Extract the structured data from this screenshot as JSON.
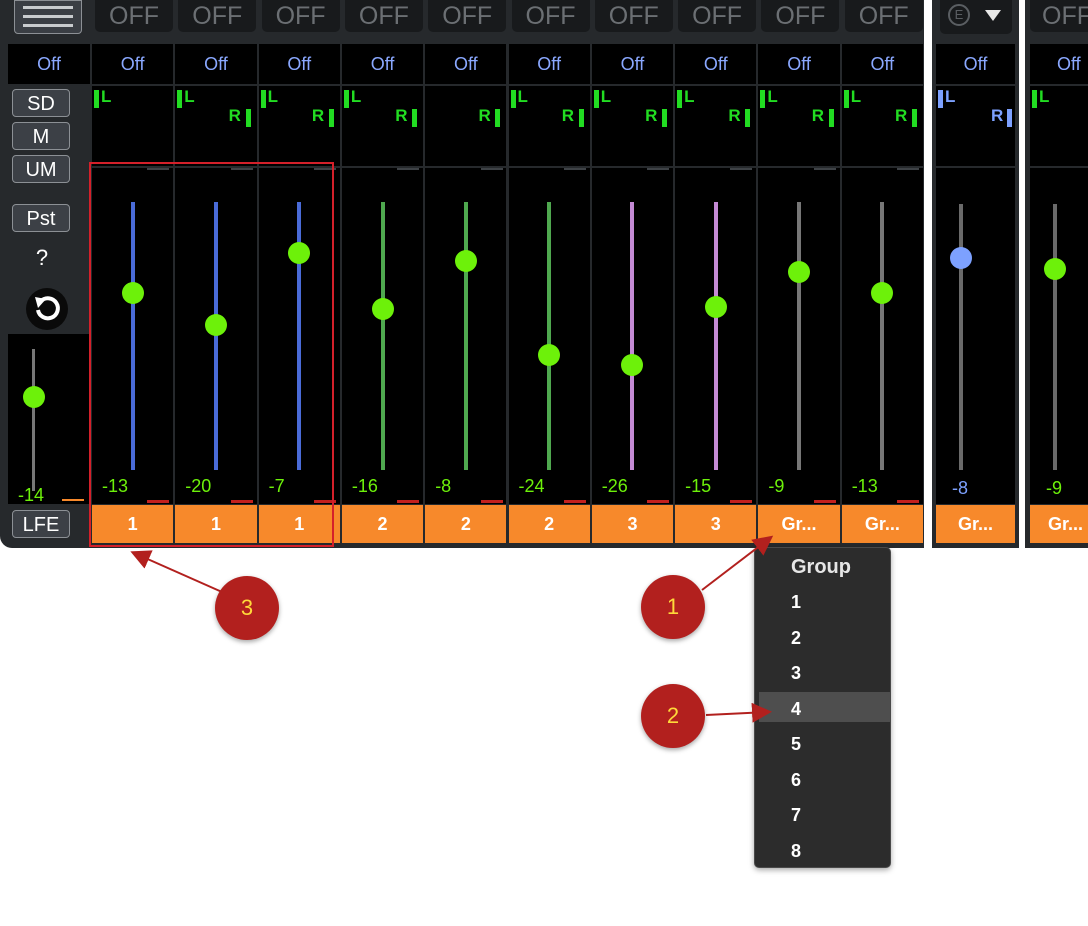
{
  "colors": {
    "panel": "#26292c",
    "fader_knob": "#6df10a",
    "fader_knob_selected": "#7da1ff",
    "route_text": "#8aa8ff",
    "group_button": "#f7892b",
    "callout": "#b2201e",
    "callout_text": "#ffd93a",
    "annotation_red": "#d4202a"
  },
  "top_bar": {
    "menu_icon": "hamburger-icon",
    "buttons": [
      "OFF",
      "OFF",
      "OFF",
      "OFF",
      "OFF",
      "OFF",
      "OFF",
      "OFF",
      "OFF",
      "OFF"
    ],
    "e_dropdown": {
      "label": "E",
      "icon": "chevron-down-icon"
    },
    "partial_button": "OFF"
  },
  "side_panel": {
    "route_label": "Off",
    "buttons": [
      "SD",
      "M",
      "UM",
      "Pst"
    ],
    "help": "?",
    "reset_icon": "reset-icon",
    "lfe_value": "-14",
    "lfe_level": 0.66,
    "lfe_button": "LFE"
  },
  "channels": [
    {
      "route": "Off",
      "pan": "L",
      "db": "-13",
      "group": "1",
      "level": 0.66,
      "color": "#4a6bd8"
    },
    {
      "route": "Off",
      "pan": "LR",
      "db": "-20",
      "group": "1",
      "level": 0.54,
      "color": "#4a6bd8"
    },
    {
      "route": "Off",
      "pan": "LR",
      "db": "-7",
      "group": "1",
      "level": 0.81,
      "color": "#4a6bd8"
    },
    {
      "route": "Off",
      "pan": "LR",
      "db": "-16",
      "group": "2",
      "level": 0.6,
      "color": "#4fa84f"
    },
    {
      "route": "Off",
      "pan": "R",
      "db": "-8",
      "group": "2",
      "level": 0.78,
      "color": "#4fa84f"
    },
    {
      "route": "Off",
      "pan": "LR",
      "db": "-24",
      "group": "2",
      "level": 0.43,
      "color": "#4fa84f"
    },
    {
      "route": "Off",
      "pan": "LR",
      "db": "-26",
      "group": "3",
      "level": 0.39,
      "color": "#c48ad4"
    },
    {
      "route": "Off",
      "pan": "LR",
      "db": "-15",
      "group": "3",
      "level": 0.61,
      "color": "#c48ad4"
    },
    {
      "route": "Off",
      "pan": "LR",
      "db": "-9",
      "group": "Gr...",
      "level": 0.74,
      "color": "#777777"
    },
    {
      "route": "Off",
      "pan": "LR",
      "db": "-13",
      "group": "Gr...",
      "level": 0.66,
      "color": "#777777"
    }
  ],
  "right_channels": [
    {
      "route": "Off",
      "pan": "LR",
      "db": "-8",
      "group": "Gr...",
      "level": 0.79,
      "selected": true
    },
    {
      "route": "Off",
      "pan": "L",
      "db": "-9",
      "group": "Gr...",
      "level": 0.75
    }
  ],
  "group_menu": {
    "title": "Group",
    "items": [
      "1",
      "2",
      "3",
      "4",
      "5",
      "6",
      "7",
      "8"
    ],
    "highlighted": "4"
  },
  "callouts": [
    "1",
    "2",
    "3"
  ]
}
